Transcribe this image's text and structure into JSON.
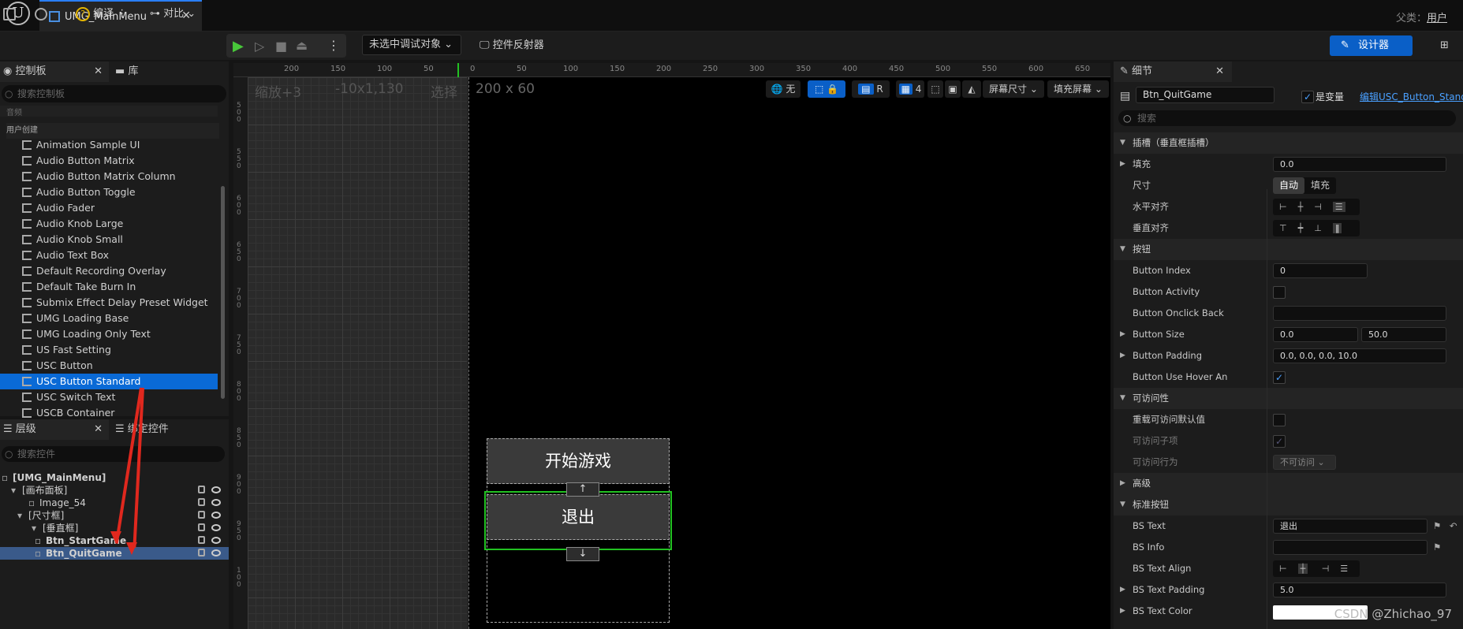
{
  "titlebar": {
    "tab_label": "UMG_MainMenu",
    "parent_label": "父类：",
    "parent_value": "用户"
  },
  "toolbar": {
    "compile_label": "编译",
    "diff_label": "对比",
    "debug_select": "未选中调试对象",
    "reflector_label": "控件反射器",
    "designer_label": "设计器"
  },
  "palette": {
    "tab_palette": "控制板",
    "tab_library": "库",
    "search_placeholder": "搜索控制板",
    "cat_audio": "音频",
    "cat_user": "用户创建",
    "items": [
      "Animation Sample UI",
      "Audio Button Matrix",
      "Audio Button Matrix Column",
      "Audio Button Toggle",
      "Audio Fader",
      "Audio Knob Large",
      "Audio Knob Small",
      "Audio Text Box",
      "Default Recording Overlay",
      "Default Take Burn In",
      "Submix Effect Delay Preset Widget",
      "UMG Loading Base",
      "UMG Loading Only Text",
      "US Fast Setting",
      "USC Button",
      "USC Button Standard",
      "USC Switch Text",
      "USCB Container"
    ]
  },
  "hierarchy": {
    "tab_hierarchy": "层级",
    "tab_bind": "绑定控件",
    "search_placeholder": "搜索控件",
    "rows": [
      "[UMG_MainMenu]",
      "[画布面板]",
      "Image_54",
      "[尺寸框]",
      "[垂直框]",
      "Btn_StartGame",
      "Btn_QuitGame"
    ]
  },
  "canvas": {
    "zoom": "缩放+3",
    "coords": "-10x1,130",
    "select": "选择",
    "size": "200 x 60",
    "view_none": "无",
    "r_btn": "R",
    "grid_num": "4",
    "screen_size": "屏幕尺寸",
    "fill_screen": "填充屏幕",
    "ruler_top": [
      "200",
      "150",
      "100",
      "50",
      "0",
      "50",
      "100",
      "150",
      "200",
      "250",
      "300",
      "350",
      "400",
      "450",
      "500",
      "550",
      "600",
      "650"
    ],
    "ruler_left": [
      "5\n0\n0",
      "5\n5\n0",
      "6\n0\n0",
      "6\n5\n0",
      "7\n0\n0",
      "7\n5\n0",
      "8\n0\n0",
      "8\n5\n0",
      "9\n0\n0",
      "9\n5\n0",
      "1\n0\n0"
    ],
    "btn_start": "开始游戏",
    "btn_quit": "退出",
    "up_arrow": "↑",
    "down_arrow": "↓"
  },
  "details": {
    "tab": "细节",
    "widget_name": "Btn_QuitGame",
    "is_variable": "是变量",
    "edit_link": "编辑USC_Button_Stand",
    "search_placeholder": "搜索",
    "sec_slot": "插槽（垂直框插槽）",
    "fill_label": "填充",
    "fill_value": "0.0",
    "size_label": "尺寸",
    "size_auto": "自动",
    "size_fill": "填充",
    "halign_label": "水平对齐",
    "valign_label": "垂直对齐",
    "sec_button": "按钮",
    "button_index": "Button Index",
    "button_index_val": "0",
    "button_activity": "Button Activity",
    "button_onclick": "Button Onclick Back",
    "button_size": "Button Size",
    "button_size_x": "0.0",
    "button_size_y": "50.0",
    "button_padding": "Button Padding",
    "button_padding_val": "0.0, 0.0, 0.0, 10.0",
    "button_hover": "Button Use Hover An",
    "sec_access": "可访问性",
    "override_access": "重载可访问默认值",
    "access_children": "可访问子项",
    "access_behavior": "可访问行为",
    "access_behavior_val": "不可访问",
    "sec_advanced": "高级",
    "sec_std": "标准按钮",
    "bs_text": "BS Text",
    "bs_text_val": "退出",
    "bs_info": "BS Info",
    "bs_text_align": "BS Text Align",
    "bs_text_padding": "BS Text Padding",
    "bs_text_padding_val": "5.0",
    "bs_text_color": "BS Text Color"
  },
  "watermark": "CSDN @Zhichao_97",
  "colors": {
    "accent": "#0a5fc7",
    "selection": "#0a6ad6",
    "arrow": "#e0281e",
    "outline": "#22c122"
  }
}
